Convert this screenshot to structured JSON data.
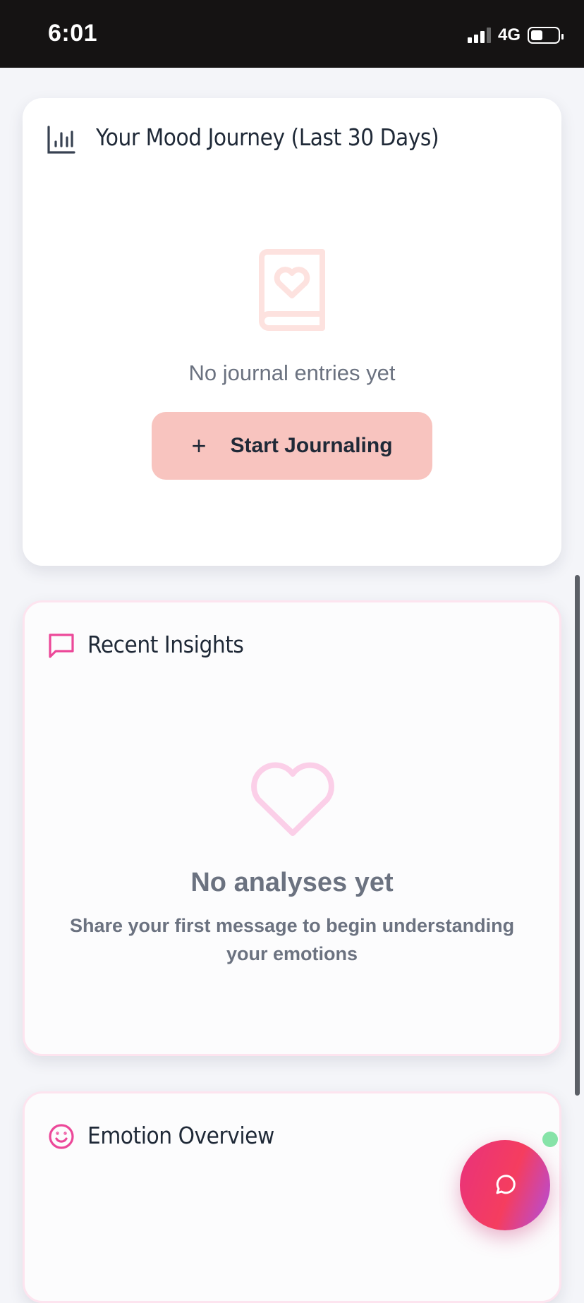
{
  "status_bar": {
    "time": "6:01",
    "network": "4G",
    "signal_bars_filled": 3,
    "battery_level": 0.45
  },
  "mood_card": {
    "title": "Your Mood Journey (Last 30 Days)",
    "title_icon": "bar-chart-icon",
    "empty_icon": "journal-heart-icon",
    "empty_text": "No journal entries yet",
    "button_label": "Start Journaling",
    "button_icon": "plus-icon"
  },
  "insights_card": {
    "title": "Recent Insights",
    "title_icon": "message-square-icon",
    "empty_icon": "heart-icon",
    "empty_title": "No analyses yet",
    "empty_text": "Share your first message to begin understanding your emotions"
  },
  "emotion_card": {
    "title": "Emotion Overview",
    "title_icon": "smile-icon"
  },
  "chat_fab": {
    "icon": "chat-bubble-icon",
    "online_indicator_color": "#86e3a8"
  },
  "colors": {
    "accent_pink": "#ec4899",
    "button_bg": "#f8c4bf",
    "muted_text": "#6b7280",
    "title_text": "#1f2937"
  }
}
